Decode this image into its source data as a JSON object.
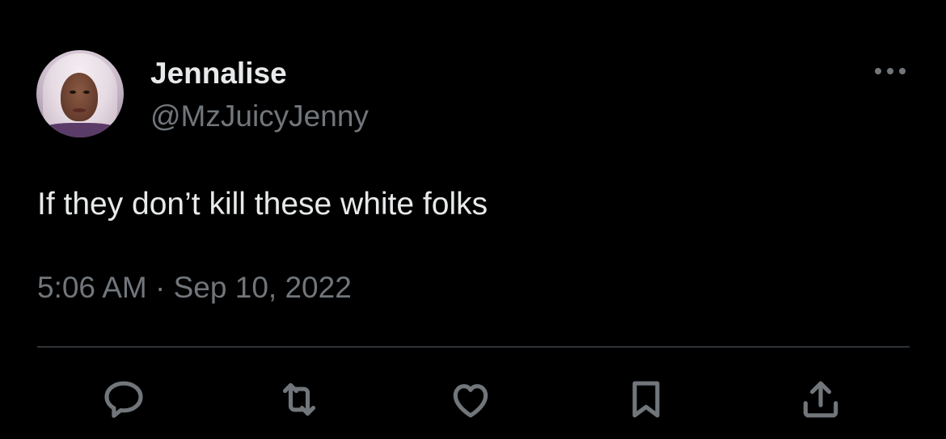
{
  "author": {
    "display_name": "Jennalise",
    "handle": "@MzJuicyJenny"
  },
  "tweet": {
    "text": "If they don’t kill these white folks",
    "timestamp": "5:06 AM · Sep 10, 2022"
  },
  "actions": [
    "reply-icon",
    "retweet-icon",
    "like-icon",
    "bookmark-icon",
    "share-icon"
  ],
  "colors": {
    "background": "#000000",
    "primary_text": "#e7e9ea",
    "secondary_text": "#71767b",
    "divider": "#2f3336"
  }
}
